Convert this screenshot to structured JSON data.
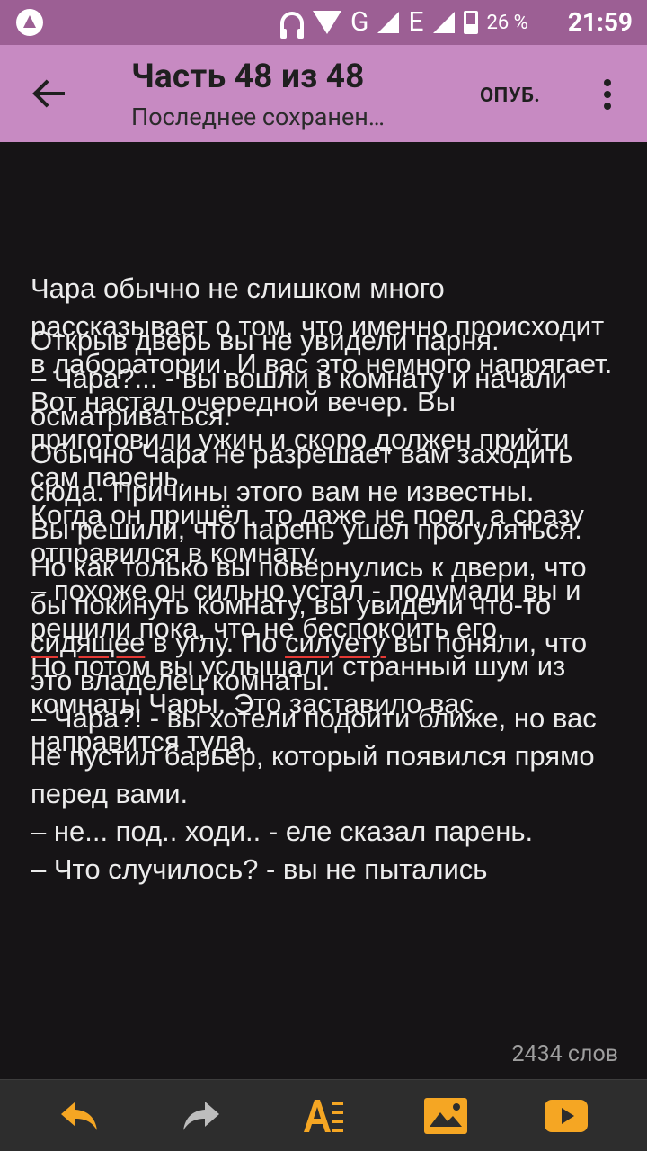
{
  "status_bar": {
    "network_type": "G",
    "network_type_2": "E",
    "battery_percent": "26 %",
    "time": "21:59"
  },
  "app_bar": {
    "title": "Часть 48 из 48",
    "subtitle": "Последнее сохранен…",
    "publish_label": "ОПУБ."
  },
  "content": {
    "layer1_paragraphs": [
      "Чара обычно не слишком много рассказывает о том, что именно происходит в лаборатории. И вас это немного напрягает.",
      "Вот настал очередной вечер. Вы приготовили ужин и скоро должен прийти сам парень.",
      "Когда он пришёл, то даже не поел, а сразу отправился в комнату.",
      "– похоже он сильно устал - подумали вы и решили пока, что не беспокоить его.",
      "Но потом вы услышали странный шум из комнаты Чары. Это заставило вас направится туда."
    ],
    "layer2_paragraphs": [
      "Открыв дверь вы не увидели парня.",
      "– Чара?... - вы вошли в комнату и начали осматриваться.",
      "Обычно Чара не разрешает вам заходить сюда. Причины этого вам не известны.",
      "Вы решили, что парень ушел прогуляться.",
      "Но как только вы повернулись к двери, что бы покинуть комнату, вы увидели что-то ",
      "в углу. По ",
      " вы поняли, что это владелец комнаты.",
      "– Чара?! - вы хотели подойти ближе, но вас не пустил барьер, который появился прямо перед вами.",
      "– не... под.. ходи.. - еле сказал парень.",
      "– Что случилось? - вы не пытались"
    ],
    "misspelled_1": "сидящее",
    "misspelled_2": "силуету",
    "word_count": "2434 слов"
  },
  "toolbar": {
    "icons": [
      "undo-icon",
      "redo-icon",
      "format-text-icon",
      "insert-image-icon",
      "insert-video-icon"
    ],
    "accent_color": "#f5a623"
  },
  "colors": {
    "status_bar": "#9c5f94",
    "app_bar": "#c78ac2",
    "background": "#161416",
    "text": "#ececec"
  }
}
